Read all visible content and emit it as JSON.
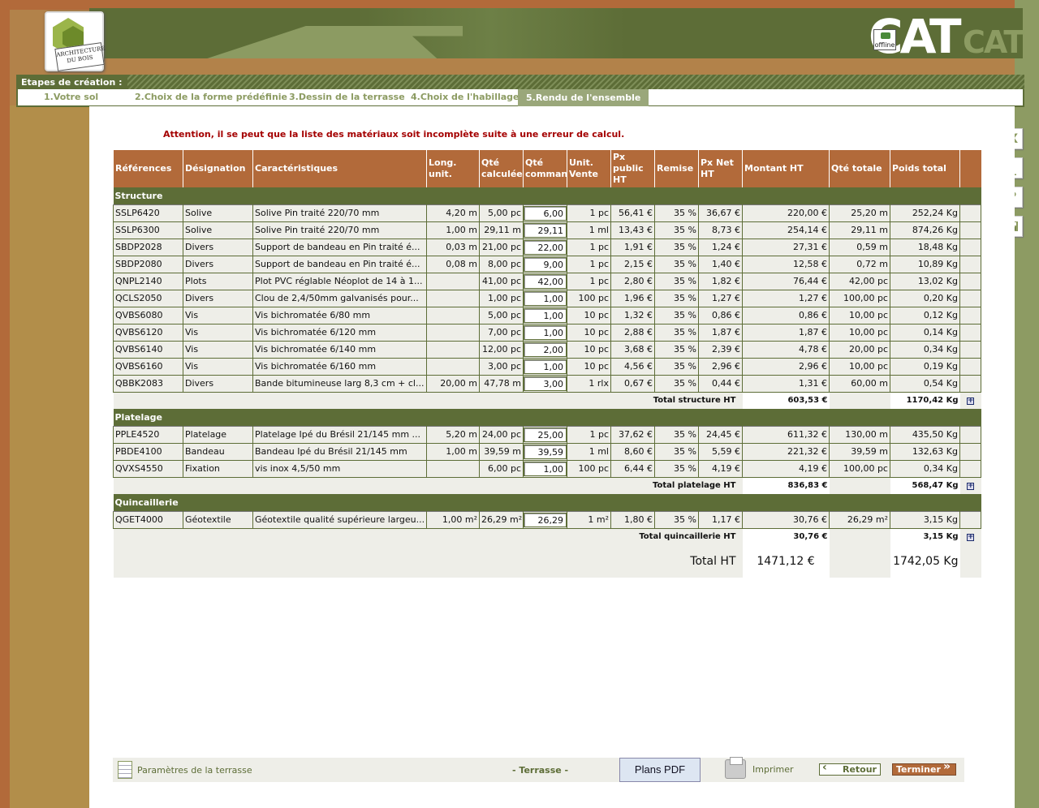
{
  "header": {
    "logo_text": "ARCHITECTURE DU BOIS",
    "brand_main": "CAT",
    "brand_sub": "CAT",
    "status": "offline"
  },
  "steps": {
    "label": "Etapes de création :",
    "items": [
      "1.Votre  sol",
      "2.Choix de la forme prédéfinie",
      "3.Dessin de la terrasse",
      "4.Choix de l'habillage",
      "5.Rendu de l'ensemble"
    ],
    "active_index": 4
  },
  "warning": "Attention, il se peut que la liste des matériaux soit incomplète suite à une erreur de calcul.",
  "side_buttons": [
    "X",
    "_",
    "?",
    "save-icon"
  ],
  "table": {
    "headers": [
      "Références",
      "Désignation",
      "Caractéristiques",
      "Long. unit.",
      "Qté calculée",
      "Qté commandée",
      "Unit. Vente",
      "Px public HT",
      "Remise",
      "Px Net HT",
      "Montant HT",
      "Qté totale",
      "Poids total"
    ],
    "sections": [
      {
        "name": "Structure",
        "rows": [
          [
            "SSLP6420",
            "Solive",
            "Solive Pin traité 220/70 mm",
            "4,20 m",
            "5,00 pc",
            "6,00",
            "1 pc",
            "56,41 €",
            "35 %",
            "36,67 €",
            "220,00 €",
            "25,20 m",
            "252,24 Kg"
          ],
          [
            "SSLP6300",
            "Solive",
            "Solive Pin traité 220/70 mm",
            "1,00 m",
            "29,11 m",
            "29,11",
            "1 ml",
            "13,43 €",
            "35 %",
            "8,73 €",
            "254,14 €",
            "29,11 m",
            "874,26 Kg"
          ],
          [
            "SBDP2028",
            "Divers",
            "Support de bandeau en Pin traité é...",
            "0,03 m",
            "21,00 pc",
            "22,00",
            "1 pc",
            "1,91 €",
            "35 %",
            "1,24 €",
            "27,31 €",
            "0,59 m",
            "18,48 Kg"
          ],
          [
            "SBDP2080",
            "Divers",
            "Support de bandeau en Pin traité é...",
            "0,08 m",
            "8,00 pc",
            "9,00",
            "1 pc",
            "2,15 €",
            "35 %",
            "1,40 €",
            "12,58 €",
            "0,72 m",
            "10,89 Kg"
          ],
          [
            "QNPL2140",
            "Plots",
            "Plot PVC réglable Néoplot de 14 à 1...",
            "",
            "41,00 pc",
            "42,00",
            "1 pc",
            "2,80 €",
            "35 %",
            "1,82 €",
            "76,44 €",
            "42,00 pc",
            "13,02 Kg"
          ],
          [
            "QCLS2050",
            "Divers",
            "Clou de 2,4/50mm galvanisés pour...",
            "",
            "1,00 pc",
            "1,00",
            "100 pc",
            "1,96 €",
            "35 %",
            "1,27 €",
            "1,27 €",
            "100,00 pc",
            "0,20 Kg"
          ],
          [
            "QVBS6080",
            "Vis",
            "Vis bichromatée 6/80 mm",
            "",
            "5,00 pc",
            "1,00",
            "10 pc",
            "1,32 €",
            "35 %",
            "0,86 €",
            "0,86 €",
            "10,00 pc",
            "0,12 Kg"
          ],
          [
            "QVBS6120",
            "Vis",
            "Vis bichromatée 6/120 mm",
            "",
            "7,00 pc",
            "1,00",
            "10 pc",
            "2,88 €",
            "35 %",
            "1,87 €",
            "1,87 €",
            "10,00 pc",
            "0,14 Kg"
          ],
          [
            "QVBS6140",
            "Vis",
            "Vis bichromatée 6/140 mm",
            "",
            "12,00 pc",
            "2,00",
            "10 pc",
            "3,68 €",
            "35 %",
            "2,39 €",
            "4,78 €",
            "20,00 pc",
            "0,34 Kg"
          ],
          [
            "QVBS6160",
            "Vis",
            "Vis bichromatée 6/160 mm",
            "",
            "3,00 pc",
            "1,00",
            "10 pc",
            "4,56 €",
            "35 %",
            "2,96 €",
            "2,96 €",
            "10,00 pc",
            "0,19 Kg"
          ],
          [
            "QBBK2083",
            "Divers",
            "Bande bitumineuse larg 8,3 cm + cl...",
            "20,00 m",
            "47,78 m",
            "3,00",
            "1 rlx",
            "0,67 €",
            "35 %",
            "0,44 €",
            "1,31 €",
            "60,00 m",
            "0,54 Kg"
          ]
        ],
        "total_label": "Total structure HT",
        "total_amount": "603,53 €",
        "total_weight": "1170,42 Kg"
      },
      {
        "name": "Platelage",
        "rows": [
          [
            "PPLE4520",
            "Platelage",
            "Platelage Ipé du Brésil 21/145 mm ...",
            "5,20 m",
            "24,00 pc",
            "25,00",
            "1 pc",
            "37,62 €",
            "35 %",
            "24,45 €",
            "611,32 €",
            "130,00 m",
            "435,50 Kg"
          ],
          [
            "PBDE4100",
            "Bandeau",
            "Bandeau Ipé du Brésil 21/145 mm",
            "1,00 m",
            "39,59 m",
            "39,59",
            "1 ml",
            "8,60 €",
            "35 %",
            "5,59 €",
            "221,32 €",
            "39,59 m",
            "132,63 Kg"
          ],
          [
            "QVXS4550",
            "Fixation",
            "vis inox 4,5/50 mm",
            "",
            "6,00 pc",
            "1,00",
            "100 pc",
            "6,44 €",
            "35 %",
            "4,19 €",
            "4,19 €",
            "100,00 pc",
            "0,34 Kg"
          ]
        ],
        "total_label": "Total platelage HT",
        "total_amount": "836,83 €",
        "total_weight": "568,47 Kg"
      },
      {
        "name": "Quincaillerie",
        "rows": [
          [
            "QGET4000",
            "Géotextile",
            "Géotextile qualité supérieure largeu...",
            "1,00 m²",
            "26,29 m²",
            "26,29",
            "1 m²",
            "1,80 €",
            "35 %",
            "1,17 €",
            "30,76 €",
            "26,29 m²",
            "3,15 Kg"
          ]
        ],
        "total_label": "Total quincaillerie HT",
        "total_amount": "30,76 €",
        "total_weight": "3,15 Kg"
      }
    ],
    "grand_label": "Total HT",
    "grand_amount": "1471,12 €",
    "grand_weight": "1742,05 Kg"
  },
  "footer": {
    "params_label": "Paramètres de la terrasse",
    "center_label": "- Terrasse -",
    "pdf_label": "Plans PDF",
    "print_label": "Imprimer",
    "back_label": "Retour",
    "finish_label": "Terminer"
  },
  "colors": {
    "brown": "#b26a3a",
    "olive": "#5d6d37",
    "sage": "#8c9b62",
    "warning": "#a40000"
  }
}
